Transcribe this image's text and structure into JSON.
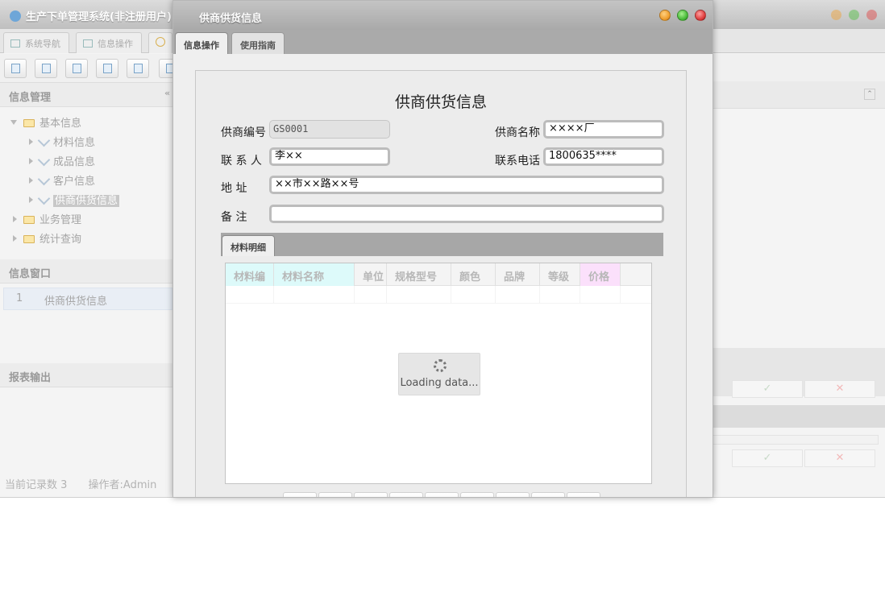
{
  "app": {
    "title": "生产下单管理系统(非注册用户)",
    "tabs": [
      {
        "label": "系统导航"
      },
      {
        "label": "信息操作"
      }
    ],
    "sidebar": {
      "info_header": "信息管理",
      "tree": [
        {
          "label": "基本信息",
          "expanded": true
        },
        {
          "label": "材料信息"
        },
        {
          "label": "成品信息"
        },
        {
          "label": "客户信息"
        },
        {
          "label": "供商供货信息",
          "selected": true
        },
        {
          "label": "业务管理"
        },
        {
          "label": "统计查询"
        }
      ],
      "window_header": "信息窗口",
      "windows": [
        {
          "index": "1",
          "label": "供商供货信息"
        }
      ],
      "report_header": "报表输出"
    },
    "status": {
      "record_count": "当前记录数 3",
      "operator": "操作者:Admin"
    },
    "right_buttons": {
      "confirm": "✓",
      "cancel": "✕"
    }
  },
  "dialog": {
    "title": "供商供货信息",
    "tabs": [
      {
        "label": "信息操作",
        "active": true
      },
      {
        "label": "使用指南",
        "active": false
      }
    ],
    "form": {
      "heading": "供商供货信息",
      "supplier_code_label": "供商编号",
      "supplier_code_value": "GS0001",
      "supplier_name_label": "供商名称",
      "supplier_name_value": "××××厂",
      "contact_label": "联 系 人",
      "contact_value": "李××",
      "phone_label": "联系电话",
      "phone_value": "1800635****",
      "address_label": "地 址",
      "address_value": "××市××路××号",
      "remark_label": "备 注",
      "remark_value": ""
    },
    "detail_tab": "材料明细",
    "grid": {
      "columns": [
        "材料编",
        "材料名称",
        "单位",
        "规格型号",
        "颜色",
        "品牌",
        "等级",
        "价格"
      ]
    },
    "loading_text": "Loading data..."
  },
  "colors": {
    "dialog_titlebar": "#b4b4b4",
    "tab_strip": "#aaaaaa",
    "column_cyan": "#ddfafa",
    "column_pink": "#fbe0fb",
    "ctrl_minimize": "#f0a030",
    "ctrl_maximize": "#4cbc3c",
    "ctrl_close": "#e04040"
  }
}
